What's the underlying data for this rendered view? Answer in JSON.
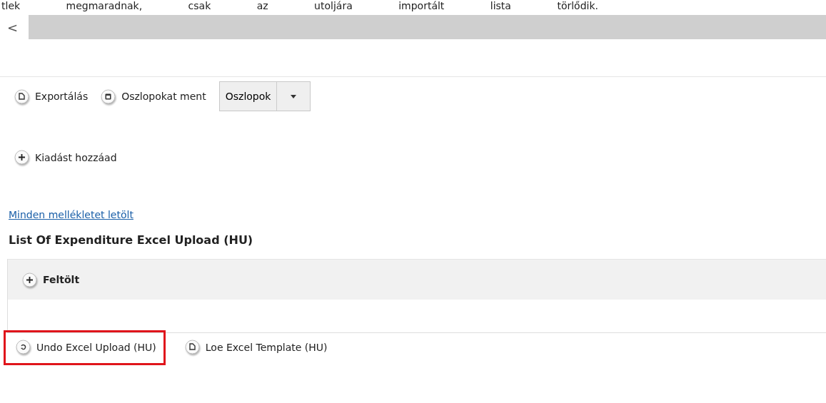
{
  "intro_text": "tlek megmaradnak, csak az utoljára importált lista törlődik.",
  "scrollbar": {
    "arrow": "<"
  },
  "toolbar": [
    {
      "kind": "export",
      "label": "Exportálás"
    },
    {
      "kind": "save",
      "label": "Oszlopokat ment"
    },
    {
      "kind": "dropdown",
      "label": "Oszlopok"
    }
  ],
  "add_button": {
    "label": "Kiadást hozzáad"
  },
  "download_link": "Minden mellékletet letölt",
  "section": {
    "title": "List Of Expenditure Excel Upload (HU)",
    "upload_button": "Feltölt",
    "actions": [
      {
        "kind": "undo",
        "label": "Undo Excel Upload (HU)",
        "highlighted": true
      },
      {
        "kind": "export",
        "label": "Loe Excel Template (HU)",
        "highlighted": false
      }
    ]
  }
}
